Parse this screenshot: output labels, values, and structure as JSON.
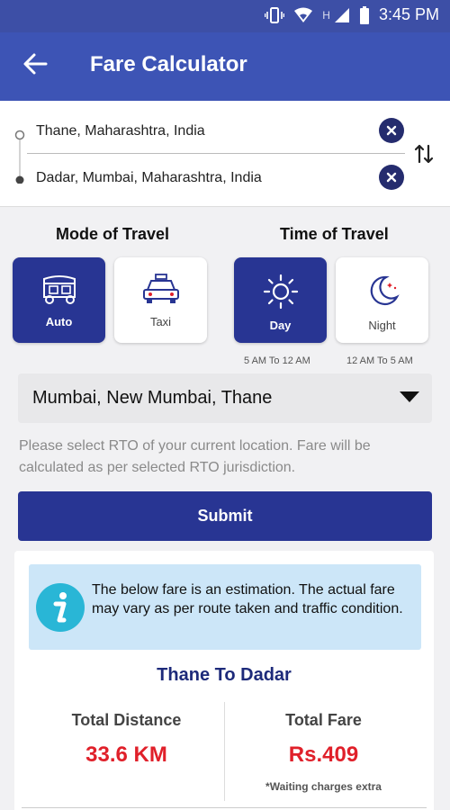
{
  "status": {
    "time": "3:45 PM",
    "network": "H"
  },
  "appbar": {
    "title": "Fare Calculator"
  },
  "route": {
    "from": "Thane, Maharashtra, India",
    "to": "Dadar, Mumbai, Maharashtra, India"
  },
  "mode": {
    "heading": "Mode of Travel",
    "options": [
      {
        "label": "Auto",
        "selected": true
      },
      {
        "label": "Taxi",
        "selected": false
      }
    ]
  },
  "time_of_travel": {
    "heading": "Time of Travel",
    "options": [
      {
        "label": "Day",
        "hint": "5 AM To 12 AM",
        "selected": true
      },
      {
        "label": "Night",
        "hint": "12 AM To 5 AM",
        "selected": false
      }
    ]
  },
  "rto": {
    "selected": "Mumbai, New Mumbai, Thane",
    "note": "Please select RTO of your current location. Fare will be calculated as per selected RTO jurisdiction."
  },
  "submit_label": "Submit",
  "result": {
    "info": "The below fare is an estimation. The actual fare may vary as per route taken and traffic condition.",
    "trip": "Thane To Dadar",
    "distance_label": "Total Distance",
    "distance_value": "33.6 KM",
    "fare_label": "Total Fare",
    "fare_value": "Rs.409",
    "waiting_note": "*Waiting charges extra"
  },
  "colors": {
    "primary": "#283593",
    "appbar": "#3d54b5",
    "fare": "#e0202a",
    "info_bg": "#cce6f8"
  }
}
